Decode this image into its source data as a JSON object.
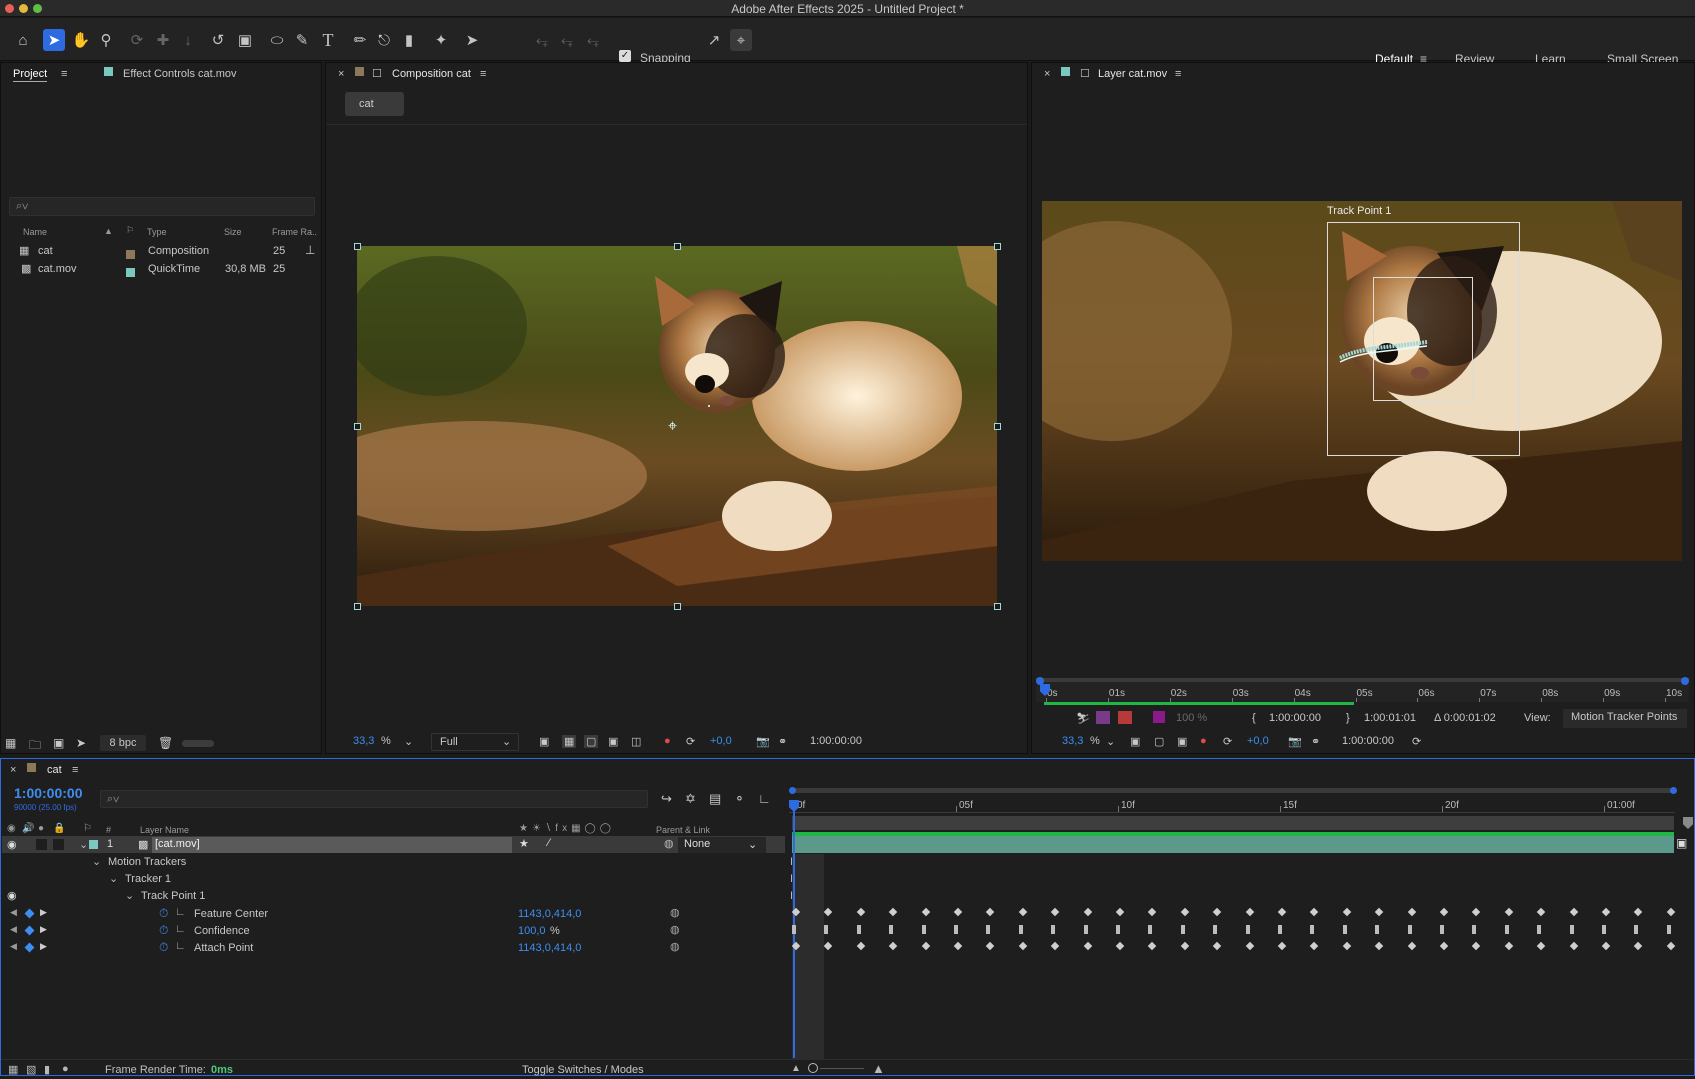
{
  "window": {
    "title": "Adobe After Effects 2025 - Untitled Project *"
  },
  "toolbar": {
    "tools": [
      "home-icon",
      "selection-icon",
      "hand-icon",
      "zoom-icon",
      "orbit-icon",
      "pan-icon",
      "dolly-icon",
      "rotate-icon",
      "pan-behind-icon",
      "ellipse-icon",
      "pen-icon",
      "type-icon",
      "brush-icon",
      "clone-stamp-icon",
      "eraser-icon",
      "roto-brush-icon",
      "puppet-pin-icon"
    ],
    "snapping_label": "Snapping",
    "workspaces": [
      "Default",
      "Review",
      "Learn",
      "Small Screen"
    ]
  },
  "project": {
    "tab_project": "Project",
    "tab_effect": "Effect Controls cat.mov",
    "search_placeholder": "⌕∨",
    "columns": {
      "name": "Name",
      "type": "Type",
      "size": "Size",
      "frame_rate": "Frame Ra.."
    },
    "items": [
      {
        "name": "cat",
        "type": "Composition",
        "size": "",
        "frame_rate": "25",
        "color": "#8a7a5a"
      },
      {
        "name": "cat.mov",
        "type": "QuickTime",
        "size": "30,8 MB",
        "frame_rate": "25",
        "color": "#7ac8c0"
      }
    ],
    "bpc": "8 bpc"
  },
  "composition": {
    "tab": "Composition cat",
    "subtab": "cat",
    "zoom": "33,3",
    "zoom_unit": "%",
    "resolution": "Full",
    "exposure": "+0,0",
    "timecode": "1:00:00:00"
  },
  "layer_panel": {
    "tab": "Layer cat.mov",
    "track_point_label": "Track Point 1",
    "ruler_ticks": [
      "0s",
      "01s",
      "02s",
      "03s",
      "04s",
      "05s",
      "06s",
      "07s",
      "08s",
      "09s",
      "10s"
    ],
    "opacity": "100 %",
    "in_time": "1:00:00:00",
    "out_time": "1:00:01:01",
    "duration": "Δ 0:00:01:02",
    "view_label": "View:",
    "view_value": "Motion Tracker Points",
    "zoom": "33,3",
    "zoom_unit": "%",
    "exposure": "+0,0",
    "timecode": "1:00:00:00"
  },
  "timeline": {
    "tab": "cat",
    "timecode": "1:00:00:00",
    "frame_info": "90000 (25.00 fps)",
    "search_placeholder": "⌕∨",
    "col_num": "#",
    "col_layer_name": "Layer Name",
    "col_parent": "Parent & Link",
    "ruler_ticks": [
      "0f",
      "05f",
      "10f",
      "15f",
      "20f",
      "01:00f"
    ],
    "layer": {
      "index": "1",
      "name": "[cat.mov]",
      "parent": "None"
    },
    "groups": {
      "motion_trackers": "Motion Trackers",
      "tracker": "Tracker 1",
      "track_point": "Track Point 1"
    },
    "properties": [
      {
        "name": "Feature Center",
        "value": "1143,0,414,0"
      },
      {
        "name": "Confidence",
        "value": "100,0",
        "unit": "%"
      },
      {
        "name": "Attach Point",
        "value": "1143,0,414,0"
      }
    ],
    "footer": {
      "render_label": "Frame Render Time:",
      "render_value": "0ms",
      "toggle_label": "Toggle Switches / Modes"
    }
  },
  "colors": {
    "accent": "#2f6be0",
    "value_blue": "#3d8ef0",
    "track_green": "#1fb846",
    "handle": "#9fd8d8"
  }
}
